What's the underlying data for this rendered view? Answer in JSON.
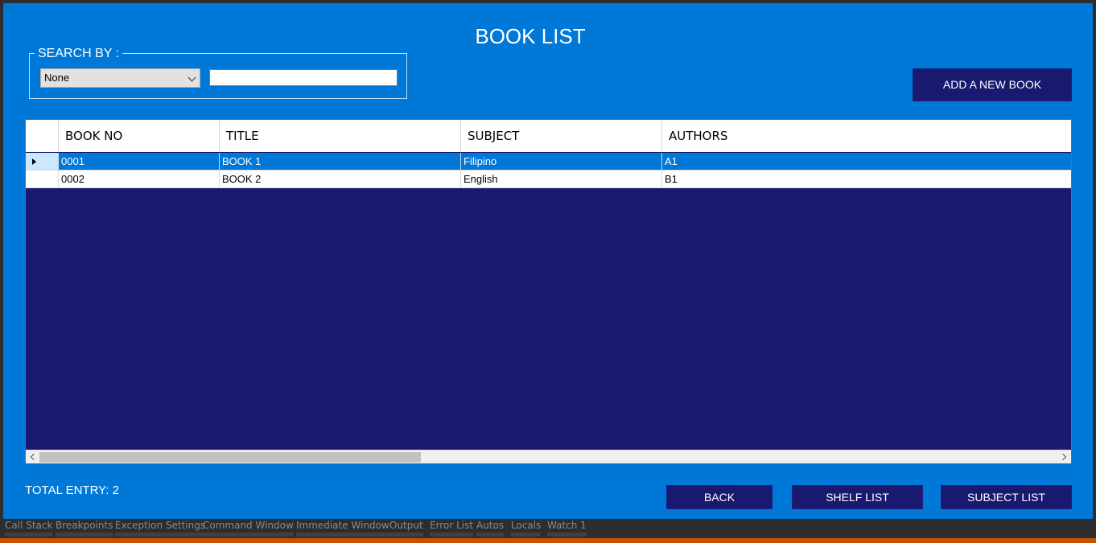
{
  "title": "BOOK LIST",
  "search": {
    "legend": "SEARCH BY :",
    "selected": "None",
    "value": ""
  },
  "buttons": {
    "add": "ADD A NEW BOOK",
    "back": "BACK",
    "shelf": "SHELF LIST",
    "subject": "SUBJECT LIST"
  },
  "grid": {
    "columns": [
      "BOOK NO",
      "TITLE",
      "SUBJECT",
      "AUTHORS"
    ],
    "rows": [
      [
        "0001",
        "BOOK 1",
        "Filipino",
        "A1"
      ],
      [
        "0002",
        "BOOK 2",
        "English",
        "B1"
      ]
    ]
  },
  "footer": {
    "total": "TOTAL ENTRY: 2"
  },
  "ide_tabs": [
    "Call Stack",
    "Breakpoints",
    "Exception Settings",
    "Command Window",
    "Immediate Window",
    "Output",
    "Error List",
    "Autos",
    "Locals",
    "Watch 1"
  ],
  "colors": {
    "form_bg": "#0078d7",
    "button_bg": "#191970",
    "grid_bg": "#191970",
    "selected_row": "#0078d7",
    "status_bar": "#ca5100"
  }
}
